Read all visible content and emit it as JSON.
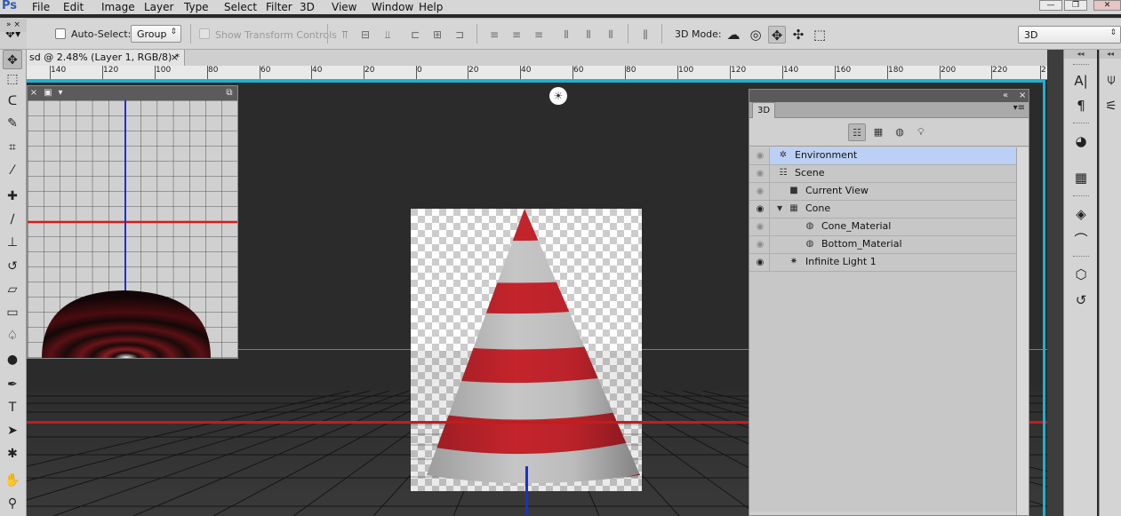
{
  "app": {
    "logo": "Ps"
  },
  "menu": [
    "File",
    "Edit",
    "Image",
    "Layer",
    "Type",
    "Select",
    "Filter",
    "3D",
    "View",
    "Window",
    "Help"
  ],
  "window_controls": {
    "minimize": "—",
    "restore": "❐",
    "close": "✕"
  },
  "options": {
    "auto_select_label": "Auto-Select:",
    "auto_select_checked": false,
    "auto_select_value": "Group",
    "show_transform_label": "Show Transform Controls",
    "mode_label": "3D Mode:",
    "workspace_value": "3D"
  },
  "document": {
    "tab_title": "sd @ 2.48% (Layer 1, RGB/8) *",
    "tab_close": "×"
  },
  "ruler": {
    "ticks": [
      "140",
      "120",
      "100",
      "80",
      "60",
      "40",
      "20",
      "0",
      "20",
      "40",
      "60",
      "80",
      "100",
      "120",
      "140",
      "160",
      "180",
      "200",
      "220",
      "2"
    ]
  },
  "panel3d": {
    "tab_label": "3D",
    "active_filter": "whole-scene",
    "rows": [
      {
        "label": "Environment",
        "eye": false,
        "icon": "environment-icon",
        "glyph": "✲",
        "indent": 0,
        "triangle": "",
        "selected": true
      },
      {
        "label": "Scene",
        "eye": false,
        "icon": "scene-icon",
        "glyph": "☷",
        "indent": 0,
        "triangle": "",
        "selected": false
      },
      {
        "label": "Current View",
        "eye": false,
        "icon": "camera-icon",
        "glyph": "■",
        "indent": 1,
        "triangle": "",
        "selected": false
      },
      {
        "label": "Cone",
        "eye": true,
        "icon": "mesh-icon",
        "glyph": "▦",
        "indent": 1,
        "triangle": "▼",
        "selected": false
      },
      {
        "label": "Cone_Material",
        "eye": false,
        "icon": "material-icon",
        "glyph": "◍",
        "indent": 2,
        "triangle": "",
        "selected": false
      },
      {
        "label": "Bottom_Material",
        "eye": false,
        "icon": "material-icon",
        "glyph": "◍",
        "indent": 2,
        "triangle": "",
        "selected": false
      },
      {
        "label": "Infinite Light 1",
        "eye": true,
        "icon": "light-icon",
        "glyph": "✷",
        "indent": 1,
        "triangle": "",
        "selected": false
      }
    ]
  },
  "colors": {
    "selection": "#bcd0f5",
    "x_axis": "#c41c1c",
    "y_axis": "#1830d8",
    "canvas_edge": "#1fb0d0"
  }
}
